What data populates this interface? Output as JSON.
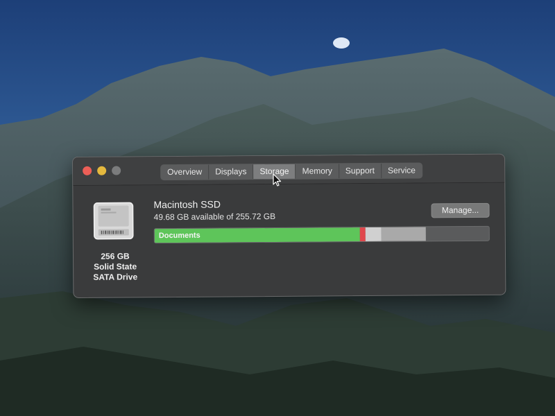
{
  "wallpaper": {
    "sky_color": "#2f5b95",
    "mountain_color": "#3a4a52"
  },
  "window": {
    "controls": {
      "close_color": "#ec5f57",
      "minimize_color": "#e4b83e",
      "zoom_color": "#7b7c7d"
    },
    "tabs": [
      {
        "label": "Overview",
        "selected": false
      },
      {
        "label": "Displays",
        "selected": false
      },
      {
        "label": "Storage",
        "selected": true
      },
      {
        "label": "Memory",
        "selected": false
      },
      {
        "label": "Support",
        "selected": false
      },
      {
        "label": "Service",
        "selected": false
      }
    ]
  },
  "drive": {
    "icon": "ssd-drive-icon",
    "capacity": "256 GB",
    "type": "Solid State",
    "interface": "SATA Drive",
    "name": "Macintosh SSD",
    "available_text": "49.68 GB available of 255.72 GB",
    "manage_label": "Manage..."
  },
  "storage_bar": {
    "total_gb": 255.72,
    "segments": [
      {
        "label": "Documents",
        "fraction": 0.615,
        "color": "#5ec55a"
      },
      {
        "label": "",
        "fraction": 0.017,
        "color": "#e0474c"
      },
      {
        "label": "",
        "fraction": 0.048,
        "color": "#d0d0d0"
      },
      {
        "label": "",
        "fraction": 0.132,
        "color": "#a9a9a9"
      }
    ]
  }
}
